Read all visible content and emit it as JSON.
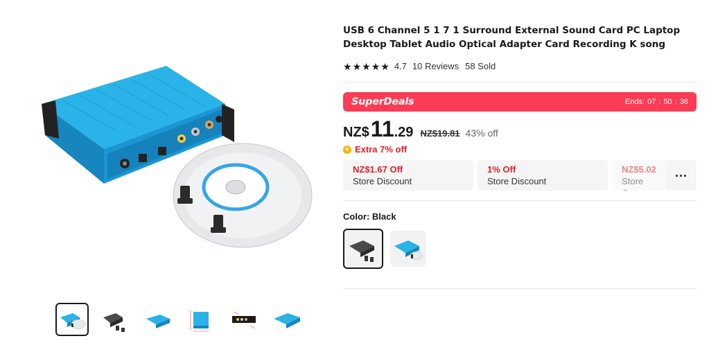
{
  "product": {
    "title": "USB 6 Channel 5 1 7 1 Surround External Sound Card PC Laptop Desktop Tablet Audio Optical Adapter Card Recording K song",
    "rating": "4.7",
    "reviews": "10 Reviews",
    "sold": "58 Sold"
  },
  "superdeals": {
    "label": "SuperDeals",
    "ends_label": "Ends:",
    "hours": "07",
    "minutes": "50",
    "seconds": "36",
    "color": "#fd3b54"
  },
  "price": {
    "currency": "NZ$",
    "integer": "11",
    "decimal": ".29",
    "original": "NZ$19.81",
    "discount": "43% off",
    "extra": "Extra 7% off"
  },
  "coupons": [
    {
      "top": "NZ$1.67 Off",
      "bottom": "Store Discount"
    },
    {
      "top": "1% Off",
      "bottom": "Store Discount"
    },
    {
      "top": "NZ$5.02",
      "bottom": "Store Cou"
    }
  ],
  "coupon_more": "...",
  "color": {
    "label": "Color:",
    "value": "Black",
    "options": [
      "Black",
      "Blue"
    ]
  },
  "icons": {
    "star": "star-icon",
    "extra": "plus-circle-icon",
    "more": "more-horizontal-icon"
  },
  "thumbnails": [
    "thumb-1",
    "thumb-2",
    "thumb-3",
    "thumb-4",
    "thumb-5",
    "thumb-6"
  ],
  "colors": {
    "accent": "#fd3b54",
    "price_red": "#e0202a",
    "card_blue": "#1ea9e1"
  }
}
